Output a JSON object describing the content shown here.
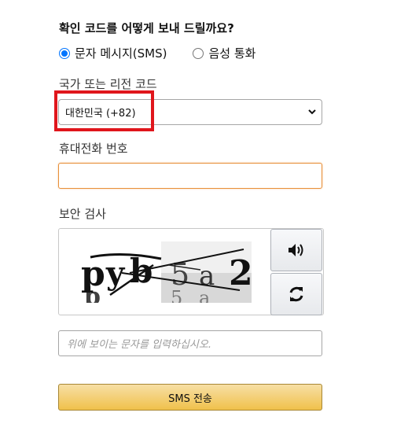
{
  "question": "확인 코드를 어떻게 보내 드릴까요?",
  "delivery_options": [
    {
      "label": "문자 메시지(SMS)",
      "checked": true
    },
    {
      "label": "음성 통화",
      "checked": false
    }
  ],
  "country_label": "국가 또는 리전 코드",
  "country_selected": "대한민국 (+82)",
  "phone_label": "휴대전화 번호",
  "phone_value": "",
  "security_label": "보안 검사",
  "captcha_text": "pyb5a2",
  "captcha_placeholder": "위에 보이는 문자를 입력하십시오.",
  "audio_icon": "speaker-icon",
  "refresh_icon": "refresh-icon",
  "submit_label": "SMS 전송",
  "highlight_color": "#e0161c",
  "button_color": "#f0c14b"
}
